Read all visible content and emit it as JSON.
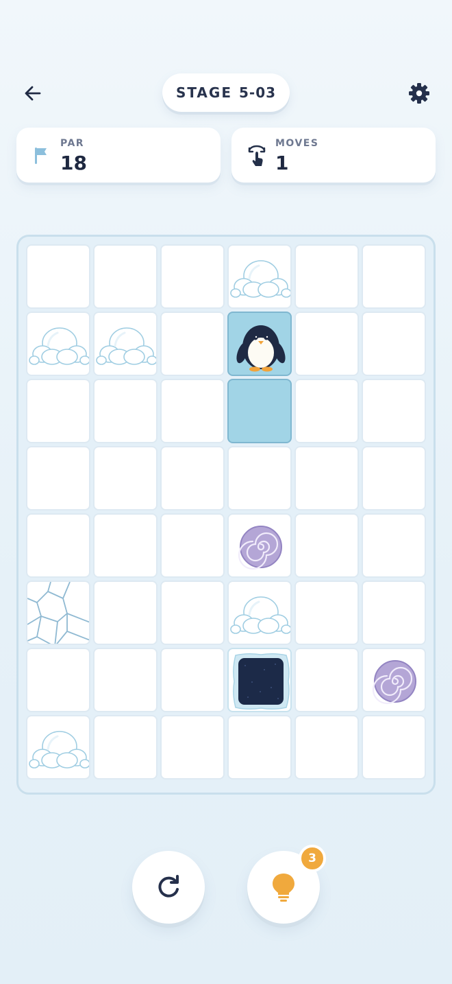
{
  "header": {
    "back_icon": "arrow-left-icon",
    "stage_label": "STAGE",
    "stage_number": "5-03",
    "settings_icon": "gear-icon"
  },
  "stats": {
    "par": {
      "label": "PAR",
      "value": "18",
      "icon": "flag-icon",
      "icon_color": "#8cbfdc"
    },
    "moves": {
      "label": "MOVES",
      "value": "1",
      "icon": "swipe-icon",
      "icon_color": "#243049"
    }
  },
  "board": {
    "rows": 8,
    "cols": 6,
    "tiles": [
      [
        "ice",
        "ice",
        "ice",
        "snow",
        "ice",
        "ice"
      ],
      [
        "snow",
        "snow",
        "ice",
        "penguin",
        "ice",
        "ice"
      ],
      [
        "ice",
        "ice",
        "ice",
        "trail",
        "ice",
        "ice"
      ],
      [
        "ice",
        "ice",
        "ice",
        "ice",
        "ice",
        "ice"
      ],
      [
        "ice",
        "ice",
        "ice",
        "whirlpool",
        "ice",
        "ice"
      ],
      [
        "cracked",
        "ice",
        "ice",
        "snow",
        "ice",
        "ice"
      ],
      [
        "ice",
        "ice",
        "ice",
        "hole",
        "ice",
        "whirlpool"
      ],
      [
        "snow",
        "ice",
        "ice",
        "ice",
        "ice",
        "ice"
      ]
    ],
    "colors": {
      "ice": "#ffffff",
      "trail": "#a1d4e6",
      "hole": "#1c2a48",
      "whirlpool": "#b4a6d6"
    }
  },
  "controls": {
    "reset_icon": "restart-icon",
    "hint_icon": "lightbulb-icon",
    "hint_count": "3",
    "accent": "#f0a93d"
  }
}
